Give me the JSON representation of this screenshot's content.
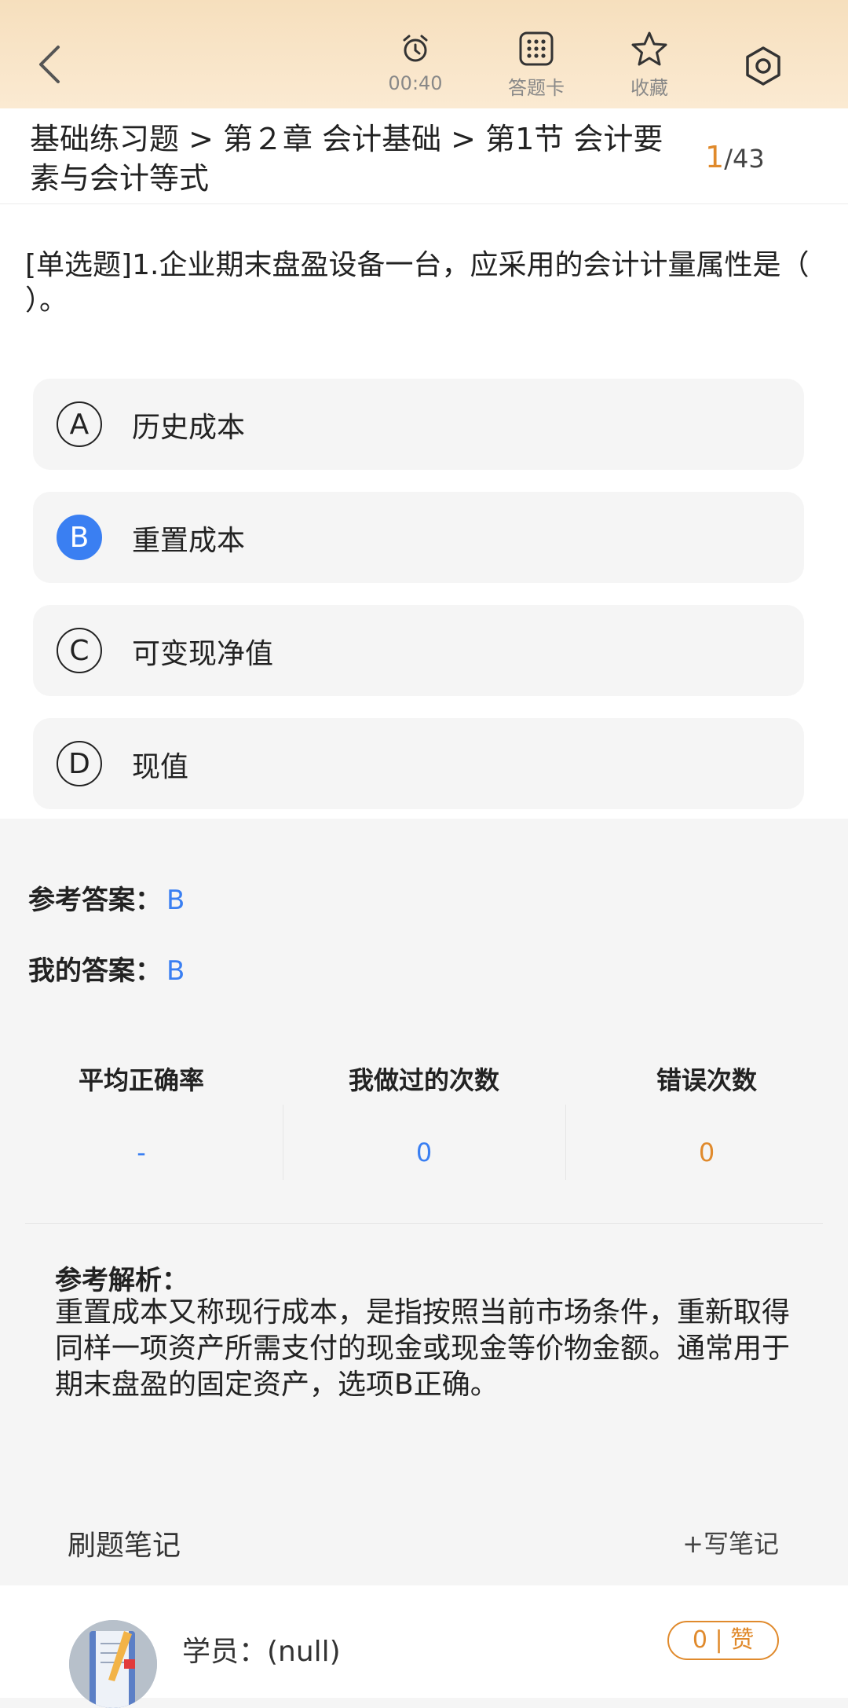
{
  "header": {
    "timer": "00:40",
    "answer_card_label": "答题卡",
    "favorite_label": "收藏"
  },
  "breadcrumb": {
    "text": "基础练习题 > 第２章 会计基础 > 第1节 会计要素与会计等式",
    "current_page": "1",
    "total_pages": "/43"
  },
  "question": {
    "text": "[单选题]1.企业期末盘盈设备一台，应采用的会计计量属性是（   ）。",
    "options": [
      {
        "letter": "A",
        "text": "历史成本"
      },
      {
        "letter": "B",
        "text": "重置成本",
        "selected": true
      },
      {
        "letter": "C",
        "text": "可变现净值"
      },
      {
        "letter": "D",
        "text": "现值"
      }
    ]
  },
  "answers": {
    "reference_label": "参考答案：",
    "reference_value": "B",
    "mine_label": "我的答案：",
    "mine_value": "B"
  },
  "stats": [
    {
      "label": "平均正确率",
      "value": "-",
      "color": "#3a7ff2"
    },
    {
      "label": "我做过的次数",
      "value": "0",
      "color": "#3a7ff2"
    },
    {
      "label": "错误次数",
      "value": "0",
      "color": "#e08a2c"
    }
  ],
  "analysis": {
    "title": "参考解析：",
    "text": "重置成本又称现行成本，是指按照当前市场条件，重新取得同样一项资产所需支付的现金或现金等价物金额。通常用于期末盘盈的固定资产，选项B正确。"
  },
  "notes": {
    "header": "刷题笔记",
    "write_label": "+写笔记",
    "items": [
      {
        "user": "学员：(null)",
        "likes": "0 | 赞"
      }
    ]
  },
  "colors": {
    "accent_blue": "#3a7ff2",
    "accent_orange": "#e08a2c",
    "topbar": "#f6dfbd"
  }
}
